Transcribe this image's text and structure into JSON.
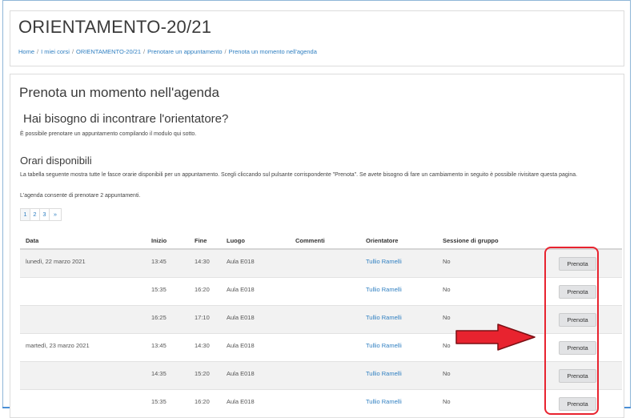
{
  "course": {
    "title": "ORIENTAMENTO-20/21"
  },
  "breadcrumb": [
    "Home",
    "I miei corsi",
    "ORIENTAMENTO-20/21",
    "Prenotare un appuntamento",
    "Prenota un momento nell'agenda"
  ],
  "page": {
    "title": "Prenota un momento nell'agenda",
    "subheading": "Hai bisogno di incontrare l'orientatore?",
    "intro": "È possibile prenotare un appuntamento compilando il modulo qui sotto.",
    "available_heading": "Orari disponibili",
    "description": "La tabella seguente mostra tutte le fasce orarie disponibili per un appuntamento. Scegli cliccando sul pulsante corrispondente \"Prenota\". Se avete bisogno di fare un cambiamento in seguito è possibile rivisitare questa pagina.",
    "limit": "L'agenda consente di prenotare 2 appuntamenti."
  },
  "pagination": [
    "1",
    "2",
    "3",
    "»"
  ],
  "table": {
    "headers": {
      "data": "Data",
      "inizio": "Inizio",
      "fine": "Fine",
      "luogo": "Luogo",
      "commenti": "Commenti",
      "orientatore": "Orientatore",
      "sessione": "Sessione di gruppo"
    },
    "rows": [
      {
        "date": "lunedì, 22 marzo 2021",
        "start": "13:45",
        "end": "14:30",
        "place": "Aula E018",
        "comments": "",
        "advisor": "Tullio Ramelli",
        "group": "No",
        "action": "Prenota"
      },
      {
        "date": "",
        "start": "15:35",
        "end": "16:20",
        "place": "Aula E018",
        "comments": "",
        "advisor": "Tullio Ramelli",
        "group": "No",
        "action": "Prenota"
      },
      {
        "date": "",
        "start": "16:25",
        "end": "17:10",
        "place": "Aula E018",
        "comments": "",
        "advisor": "Tullio Ramelli",
        "group": "No",
        "action": "Prenota"
      },
      {
        "date": "martedì, 23 marzo 2021",
        "start": "13:45",
        "end": "14:30",
        "place": "Aula E018",
        "comments": "",
        "advisor": "Tullio Ramelli",
        "group": "No",
        "action": "Prenota"
      },
      {
        "date": "",
        "start": "14:35",
        "end": "15:20",
        "place": "Aula E018",
        "comments": "",
        "advisor": "Tullio Ramelli",
        "group": "No",
        "action": "Prenota"
      },
      {
        "date": "",
        "start": "15:35",
        "end": "16:20",
        "place": "Aula E018",
        "comments": "",
        "advisor": "Tullio Ramelli",
        "group": "No",
        "action": "Prenota"
      }
    ]
  },
  "annotation": {
    "highlight_color": "#e8232f",
    "arrow_icon": "right-arrow-icon"
  }
}
